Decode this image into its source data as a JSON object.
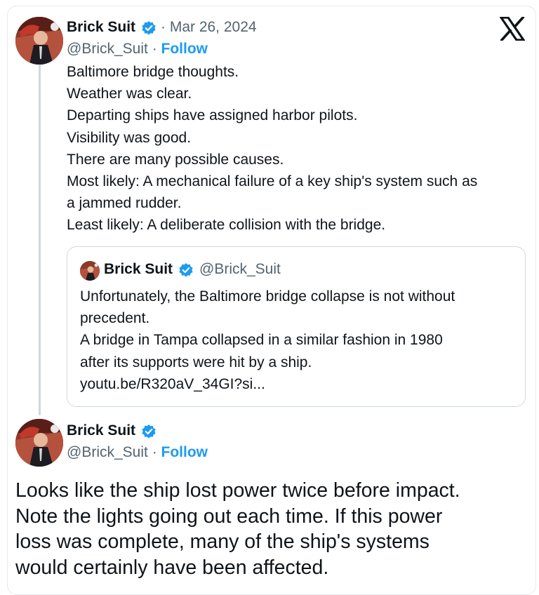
{
  "main_tweet": {
    "author_name": "Brick Suit",
    "date": "· Mar 26, 2024",
    "handle": "@Brick_Suit",
    "separator": " · ",
    "follow_label": "Follow",
    "lines": [
      "Baltimore bridge thoughts.",
      "Weather was clear.",
      "Departing ships have assigned harbor pilots.",
      "Visibility was good.",
      "There are many possible causes.",
      "Most likely: A mechanical failure of a key ship's system such as",
      "a jammed rudder.",
      "Least likely: A deliberate collision with the bridge."
    ]
  },
  "quoted_tweet": {
    "author_name": "Brick Suit",
    "handle": "@Brick_Suit",
    "lines": [
      "Unfortunately, the Baltimore bridge collapse is not without",
      "precedent.",
      "A bridge in Tampa collapsed in a similar fashion in 1980",
      "after its supports were hit by a ship.",
      "youtu.be/R320aV_34GI?si..."
    ]
  },
  "reply_tweet": {
    "author_name": "Brick Suit",
    "handle": "@Brick_Suit",
    "separator": " · ",
    "follow_label": "Follow",
    "lines": [
      "Looks like the ship lost power twice before impact.",
      "Note the lights going out each time. If this power",
      "loss was complete, many of the ship's systems",
      "would certainly have been affected."
    ]
  },
  "icons": {
    "verified": "verified-badge-icon",
    "x_logo": "x-logo-icon"
  },
  "colors": {
    "link_blue": "#1d9bf0",
    "secondary_text": "#536471",
    "primary_text": "#0f1419",
    "border": "#cfd9de"
  }
}
